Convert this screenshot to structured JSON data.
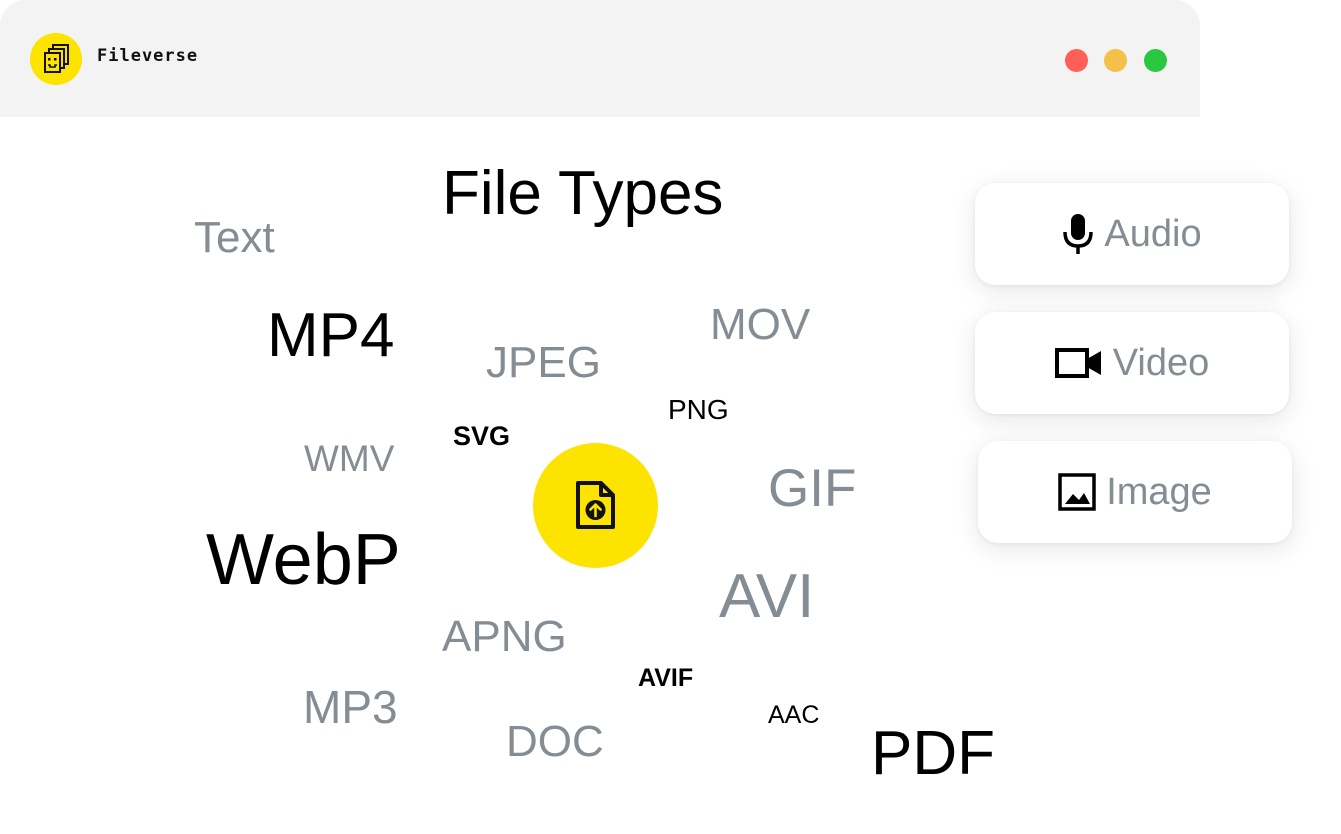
{
  "window": {
    "app_name": "Fileverse",
    "controls": [
      "close",
      "minimize",
      "maximize"
    ]
  },
  "main": {
    "title": "File Types",
    "file_types": [
      "Text",
      "MP4",
      "JPEG",
      "MOV",
      "PNG",
      "SVG",
      "WMV",
      "GIF",
      "WebP",
      "AVI",
      "APNG",
      "AVIF",
      "MP3",
      "AAC",
      "DOC",
      "PDF"
    ],
    "upload_icon": "file-upload-icon"
  },
  "categories": [
    {
      "label": "Audio",
      "icon": "microphone-icon"
    },
    {
      "label": "Video",
      "icon": "video-camera-icon"
    },
    {
      "label": "Image",
      "icon": "image-icon"
    }
  ],
  "colors": {
    "brand_yellow": "#fde300",
    "muted_text": "#858d94",
    "titlebar_bg": "#f3f3f3",
    "close": "#ff5f57",
    "minimize": "#f5c04a",
    "maximize": "#2ac840"
  }
}
